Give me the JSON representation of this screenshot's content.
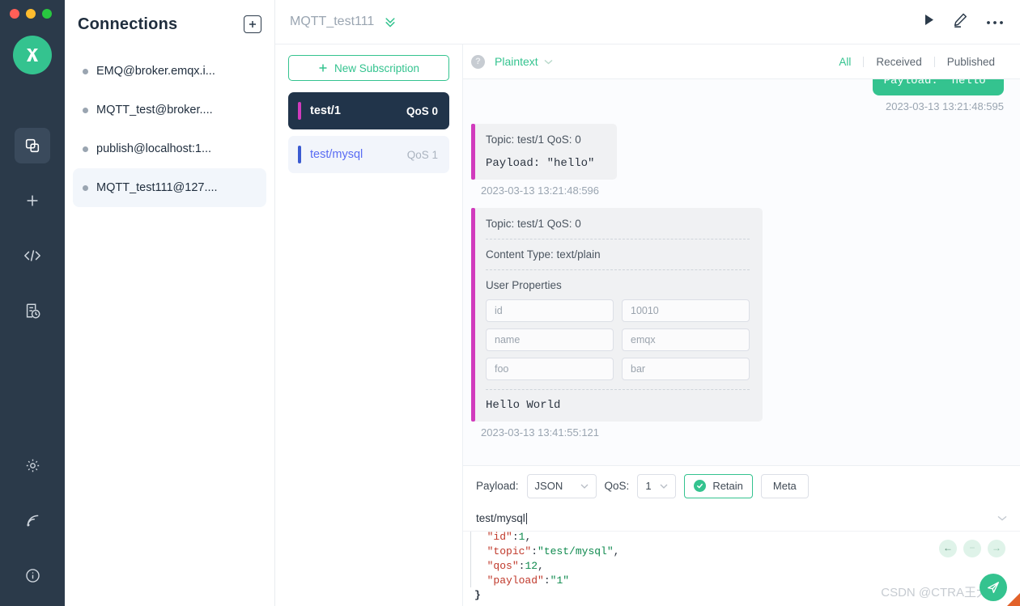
{
  "window": {
    "traffic_lights": [
      "close",
      "minimize",
      "maximize"
    ],
    "logo_name": "emqx-logo"
  },
  "rail": {
    "items": [
      {
        "name": "connections",
        "icon": "copy-stack-icon",
        "active": true
      },
      {
        "name": "new-connection",
        "icon": "plus-icon",
        "active": false
      },
      {
        "name": "scripts",
        "icon": "code-brackets-icon",
        "active": false
      },
      {
        "name": "log-history",
        "icon": "document-clock-icon",
        "active": false
      }
    ],
    "bottom_items": [
      {
        "name": "settings",
        "icon": "gear-icon"
      },
      {
        "name": "broadcast",
        "icon": "signal-icon"
      },
      {
        "name": "about",
        "icon": "info-circle-icon"
      }
    ]
  },
  "connections": {
    "title": "Connections",
    "add_icon": "plus-box-icon",
    "items": [
      {
        "label": "EMQ@broker.emqx.i...",
        "selected": false
      },
      {
        "label": "MQTT_test@broker....",
        "selected": false
      },
      {
        "label": "publish@localhost:1...",
        "selected": false
      },
      {
        "label": "MQTT_test111@127....",
        "selected": true
      }
    ]
  },
  "topbar": {
    "title": "MQTT_test111",
    "expand_icon": "double-chevron-down-icon",
    "actions": [
      {
        "name": "connect-play-button",
        "icon": "play-icon"
      },
      {
        "name": "edit-button",
        "icon": "pencil-icon"
      },
      {
        "name": "more-options-button",
        "icon": "ellipsis-icon"
      }
    ]
  },
  "subscriptions": {
    "new_button_label": "New Subscription",
    "new_button_icon": "plus-icon",
    "items": [
      {
        "topic": "test/1",
        "qos": "QoS 0",
        "color": "#d13bbd",
        "style": "dark"
      },
      {
        "topic": "test/mysql",
        "qos": "QoS 1",
        "color": "#3b5bd1",
        "style": "light"
      }
    ]
  },
  "messages_toolbar": {
    "help_icon": "question-circle-icon",
    "format": "Plaintext",
    "format_chevron": "chevron-down-icon",
    "tabs": [
      {
        "label": "All",
        "active": true
      },
      {
        "label": "Received",
        "active": false
      },
      {
        "label": "Published",
        "active": false
      }
    ]
  },
  "messages": [
    {
      "direction": "out",
      "payload": "Payload: \"hello\"",
      "timestamp": "2023-03-13 13:21:48:595"
    },
    {
      "direction": "in",
      "meta": "Topic: test/1    QoS: 0",
      "payload": "Payload: \"hello\"",
      "timestamp": "2023-03-13 13:21:48:596",
      "accent": "#d13bbd"
    },
    {
      "direction": "in",
      "meta": "Topic: test/1    QoS: 0",
      "content_type": "Content Type: text/plain",
      "user_properties_label": "User Properties",
      "user_properties": [
        {
          "key": "id",
          "value": "10010"
        },
        {
          "key": "name",
          "value": "emqx"
        },
        {
          "key": "foo",
          "value": "bar"
        }
      ],
      "payload": "Hello World",
      "timestamp": "2023-03-13 13:41:55:121",
      "accent": "#d13bbd"
    }
  ],
  "publish": {
    "payload_label": "Payload:",
    "payload_format": "JSON",
    "qos_label": "QoS:",
    "qos_value": "1",
    "retain_label": "Retain",
    "retain_checked": true,
    "meta_label": "Meta",
    "topic_value": "test/mysql",
    "topic_chevron": "chevron-down-icon",
    "editor_lines": [
      [
        {
          "t": "\"id\"",
          "c": "k"
        },
        {
          "t": ":",
          "c": "p"
        },
        {
          "t": "1",
          "c": "n"
        },
        {
          "t": ",",
          "c": "p"
        }
      ],
      [
        {
          "t": "\"topic\"",
          "c": "k"
        },
        {
          "t": ":",
          "c": "p"
        },
        {
          "t": "\"test/mysql\"",
          "c": "s"
        },
        {
          "t": ",",
          "c": "p"
        }
      ],
      [
        {
          "t": "\"qos\"",
          "c": "k"
        },
        {
          "t": ":",
          "c": "p"
        },
        {
          "t": "12",
          "c": "n"
        },
        {
          "t": ",",
          "c": "p"
        }
      ],
      [
        {
          "t": "\"payload\"",
          "c": "k"
        },
        {
          "t": ":",
          "c": "p"
        },
        {
          "t": "\"1\"",
          "c": "s"
        }
      ],
      [
        {
          "t": "}",
          "c": "brace"
        }
      ]
    ],
    "nav_pills": [
      {
        "name": "prev-arrow",
        "glyph": "←"
      },
      {
        "name": "collapse-dash",
        "glyph": "−"
      },
      {
        "name": "next-arrow",
        "glyph": "→"
      }
    ],
    "send_button_icon": "send-paper-plane-icon"
  },
  "watermark": "CSDN @CTRA王大侌",
  "colors": {
    "accent_green": "#34c38f",
    "sub_pink": "#d13bbd",
    "sub_blue": "#3b5bd1",
    "dark_rail": "#2b3a4a",
    "dark_sub": "#21344a"
  }
}
